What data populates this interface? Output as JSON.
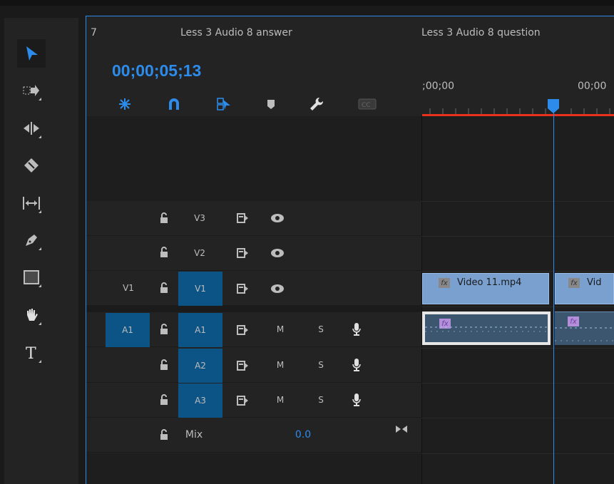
{
  "tabs": [
    "7",
    "Less 3 Audio 8 answer",
    "Less 3 Audio 8 question"
  ],
  "timecode": "00;00;05;13",
  "ruler": {
    "labels": [
      ";00;00",
      "00;00"
    ]
  },
  "tools": [
    {
      "name": "selection-tool",
      "glyph": "▶"
    },
    {
      "name": "track-select-tool",
      "glyph": "⇥"
    },
    {
      "name": "ripple-edit-tool",
      "glyph": "⇹"
    },
    {
      "name": "razor-tool",
      "glyph": "⧫"
    },
    {
      "name": "slip-tool",
      "glyph": "↔"
    },
    {
      "name": "pen-tool",
      "glyph": "✒"
    },
    {
      "name": "rectangle-tool",
      "glyph": "□"
    },
    {
      "name": "hand-tool",
      "glyph": "✋"
    },
    {
      "name": "type-tool",
      "glyph": "T"
    }
  ],
  "tracks": {
    "v3": {
      "target": "V3"
    },
    "v2": {
      "target": "V2"
    },
    "v1": {
      "source": "V1",
      "target": "V1"
    },
    "a1": {
      "source": "A1",
      "target": "A1",
      "m": "M",
      "s": "S"
    },
    "a2": {
      "target": "A2",
      "m": "M",
      "s": "S"
    },
    "a3": {
      "target": "A3",
      "m": "M",
      "s": "S"
    },
    "mix": {
      "label": "Mix",
      "value": "0.0"
    }
  },
  "clips": {
    "video1": "Video 11.mp4",
    "video2": "Vid"
  },
  "colors": {
    "accent": "#2d8ceb",
    "playhead": "#2d8ceb",
    "work_area": "#e8301c",
    "track_target": "#0d5486"
  }
}
